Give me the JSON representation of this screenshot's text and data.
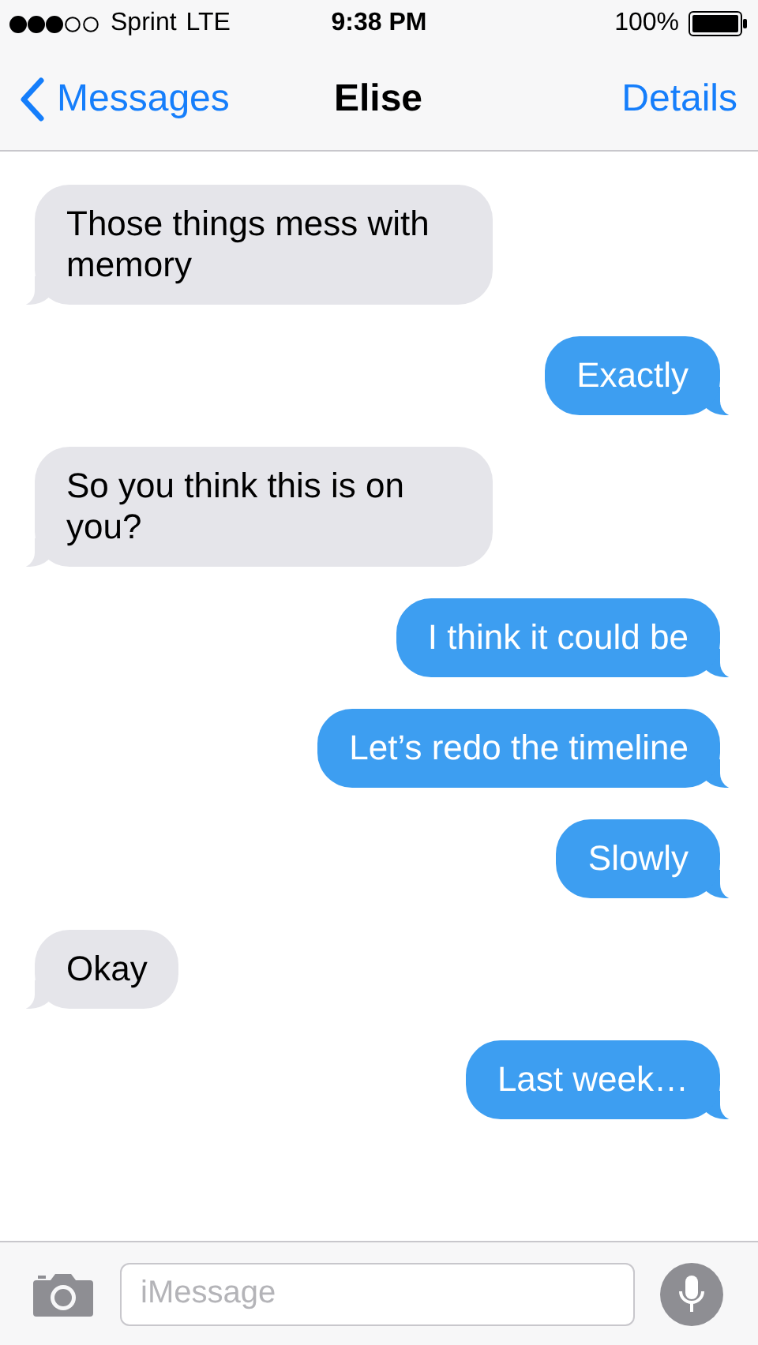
{
  "status_bar": {
    "carrier": "Sprint",
    "network": "LTE",
    "time": "9:38 PM",
    "battery": "100%"
  },
  "nav": {
    "back": "Messages",
    "title": "Elise",
    "action": "Details"
  },
  "messages": [
    {
      "kind": "received",
      "text": "Those things mess with memory"
    },
    {
      "kind": "sent",
      "text": "Exactly"
    },
    {
      "kind": "received",
      "text": "So you think this is on you?"
    },
    {
      "kind": "sent",
      "text": "I think it could be"
    },
    {
      "kind": "sent",
      "text": "Let’s redo the timeline"
    },
    {
      "kind": "sent",
      "text": "Slowly"
    },
    {
      "kind": "received",
      "text": "Okay"
    },
    {
      "kind": "sent",
      "text": "Last week…"
    }
  ],
  "composer": {
    "placeholder": "iMessage"
  }
}
